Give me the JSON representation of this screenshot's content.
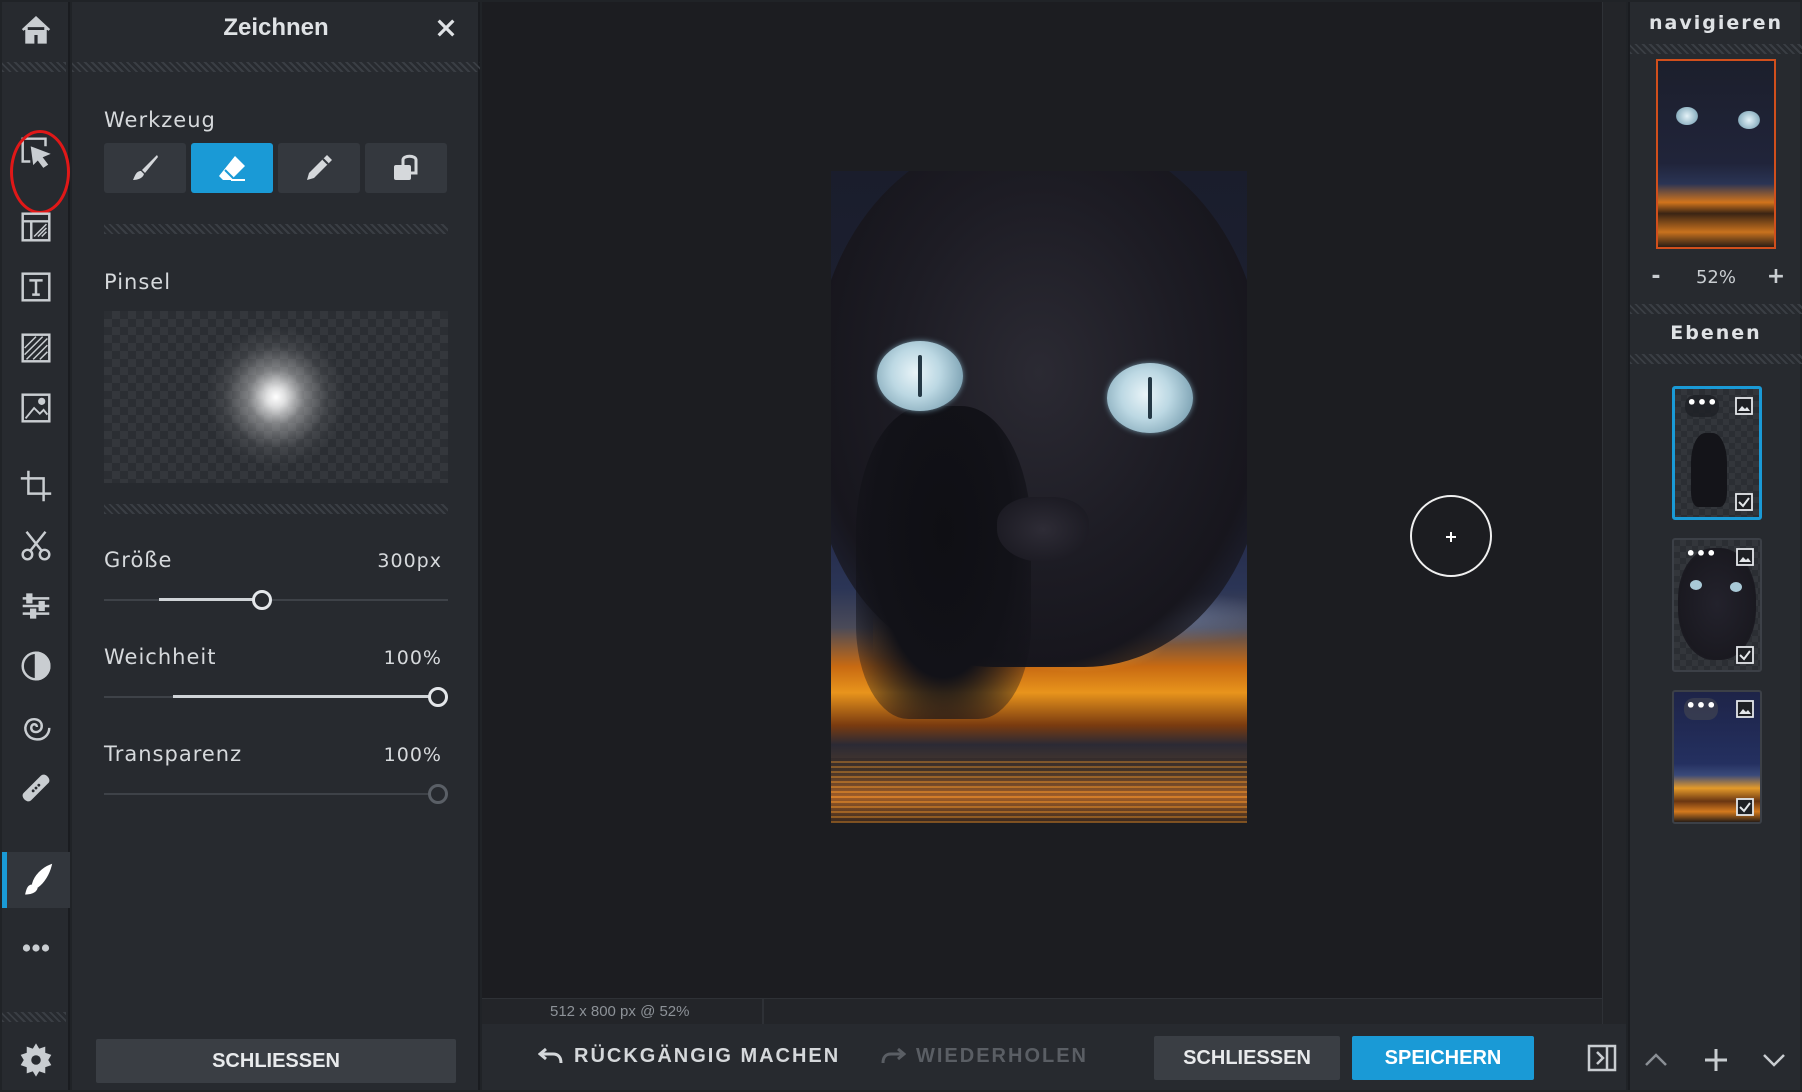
{
  "panel": {
    "title": "Zeichnen",
    "tool_section": "Werkzeug",
    "tools": [
      "brush-icon",
      "eraser-icon",
      "pencil-icon",
      "stamp-icon"
    ],
    "active_tool": "eraser-icon",
    "brush_section": "Pinsel",
    "size": {
      "label": "Größe",
      "value": "300px",
      "fraction": 0.46
    },
    "softness": {
      "label": "Weichheit",
      "value": "100%",
      "fraction": 1.0
    },
    "transparency": {
      "label": "Transparenz",
      "value": "100%",
      "fraction": 1.0
    },
    "close_label": "SCHLIESSEN"
  },
  "rail": {
    "icons": [
      "home-icon",
      "select-arrow-icon",
      "layout-icon",
      "text-icon",
      "texture-icon",
      "image-icon",
      "crop-icon",
      "cut-icon",
      "adjust-icon",
      "contrast-icon",
      "swirl-icon",
      "healing-icon",
      "draw-icon",
      "more-icon",
      "settings-icon"
    ],
    "active": "draw-icon"
  },
  "canvas": {
    "status": "512 x 800 px @ 52%"
  },
  "bottombar": {
    "undo_label": "RÜCKGÄNGIG MACHEN",
    "redo_label": "WIEDERHOLEN",
    "close_label": "SCHLIESSEN",
    "save_label": "SPEICHERN"
  },
  "navigator": {
    "title": "navigieren",
    "zoom_minus": "-",
    "zoom_value": "52%",
    "zoom_plus": "+"
  },
  "layers": {
    "title": "Ebenen",
    "items": [
      {
        "dots": "•••",
        "selected": true
      },
      {
        "dots": "•••",
        "selected": false
      },
      {
        "dots": "•••",
        "selected": false
      }
    ]
  },
  "colors": {
    "accent": "#1a9ad6",
    "background": "#1c1d21",
    "panel": "#272a2f",
    "annotation": "#e01818"
  }
}
